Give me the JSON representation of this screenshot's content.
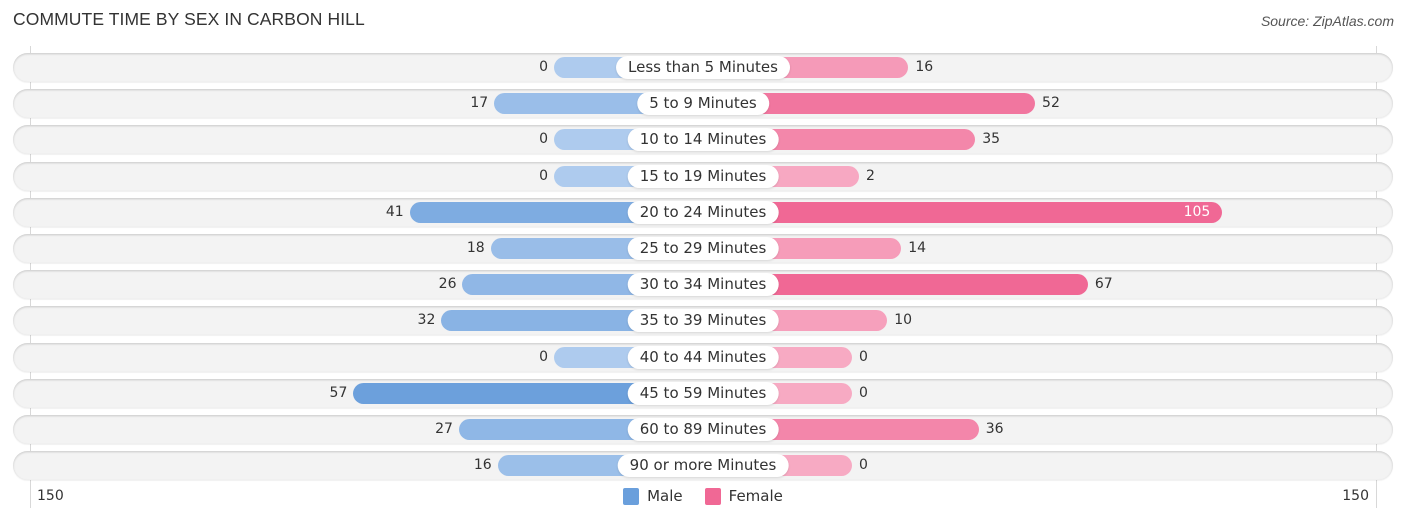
{
  "header": {
    "title": "COMMUTE TIME BY SEX IN CARBON HILL",
    "source": "Source: ZipAtlas.com"
  },
  "colors": {
    "male_strong": "#6a9fdc",
    "male_light": "#aecbee",
    "female_strong": "#f06895",
    "female_light": "#f7aac3"
  },
  "chart_data": {
    "type": "bar",
    "orientation": "horizontal-diverging",
    "title": "COMMUTE TIME BY SEX IN CARBON HILL",
    "categories": [
      "Less than 5 Minutes",
      "5 to 9 Minutes",
      "10 to 14 Minutes",
      "15 to 19 Minutes",
      "20 to 24 Minutes",
      "25 to 29 Minutes",
      "30 to 34 Minutes",
      "35 to 39 Minutes",
      "40 to 44 Minutes",
      "45 to 59 Minutes",
      "60 to 89 Minutes",
      "90 or more Minutes"
    ],
    "series": [
      {
        "name": "Male",
        "side": "left",
        "values": [
          0,
          17,
          0,
          0,
          41,
          18,
          26,
          32,
          0,
          57,
          27,
          16
        ]
      },
      {
        "name": "Female",
        "side": "right",
        "values": [
          16,
          52,
          35,
          2,
          105,
          14,
          67,
          10,
          0,
          0,
          36,
          0
        ]
      }
    ],
    "axis": {
      "left_label": "150",
      "right_label": "150",
      "range": [
        150,
        150
      ]
    },
    "legend": [
      "Male",
      "Female"
    ],
    "legend_position": "bottom-center",
    "grid": false
  }
}
